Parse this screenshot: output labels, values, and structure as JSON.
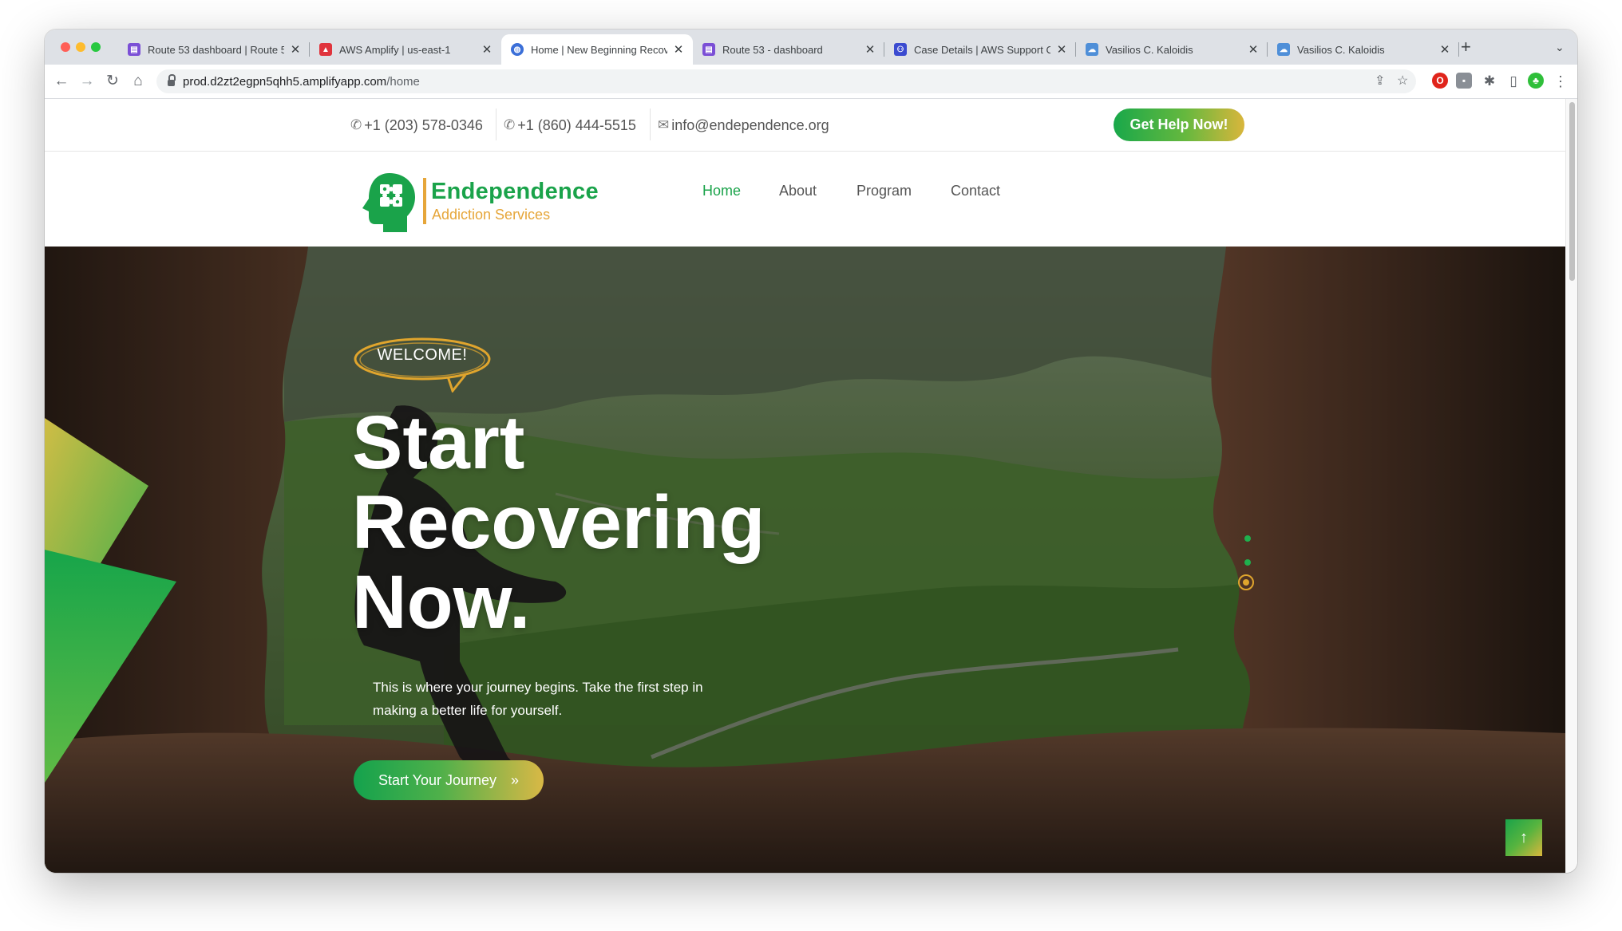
{
  "browser": {
    "tabs": [
      {
        "title": "Route 53 dashboard | Route 5",
        "favicon_color": "#7b4fd6",
        "favicon_glyph": "▤"
      },
      {
        "title": "AWS Amplify | us-east-1",
        "favicon_color": "#e0343d",
        "favicon_glyph": "▲"
      },
      {
        "title": "Home | New Beginning Recove",
        "favicon_color": "#3b6fd8",
        "favicon_glyph": "◍"
      },
      {
        "title": "Route 53 - dashboard",
        "favicon_color": "#7b4fd6",
        "favicon_glyph": "▤"
      },
      {
        "title": "Case Details | AWS Support C",
        "favicon_color": "#3b4bd0",
        "favicon_glyph": "⚇"
      },
      {
        "title": "Vasilios C. Kaloidis",
        "favicon_color": "#4f8fd8",
        "favicon_glyph": "☁"
      },
      {
        "title": "Vasilios C. Kaloidis",
        "favicon_color": "#4f8fd8",
        "favicon_glyph": "☁"
      }
    ],
    "new_tab_icon": "+",
    "tab_menu_icon": "⌄",
    "url_host": "prod.d2zt2egpn5qhh5.amplifyapp.com",
    "url_path": "/home"
  },
  "topbar": {
    "phone1": "+1 (203) 578-0346",
    "phone2": "+1 (860) 444-5515",
    "email": "info@endependence.org",
    "help_button": "Get Help Now!"
  },
  "brand": {
    "name": "Endependence",
    "tagline": "Addiction Services"
  },
  "nav": {
    "items": [
      {
        "label": "Home",
        "active": true
      },
      {
        "label": "About",
        "active": false
      },
      {
        "label": "Program",
        "active": false
      },
      {
        "label": "Contact",
        "active": false
      }
    ]
  },
  "hero": {
    "badge": "WELCOME!",
    "headline": [
      "Start",
      "Recovering",
      "Now."
    ],
    "lead": "This is where your journey begins. Take the first step in making a better life for yourself.",
    "cta": "Start Your Journey",
    "cta_icon": "»",
    "scroll_top_icon": "↑",
    "slider_dots": 3,
    "active_slide": 3
  },
  "colors": {
    "brand_green": "#1aa34a",
    "brand_gold": "#e6a63a"
  }
}
